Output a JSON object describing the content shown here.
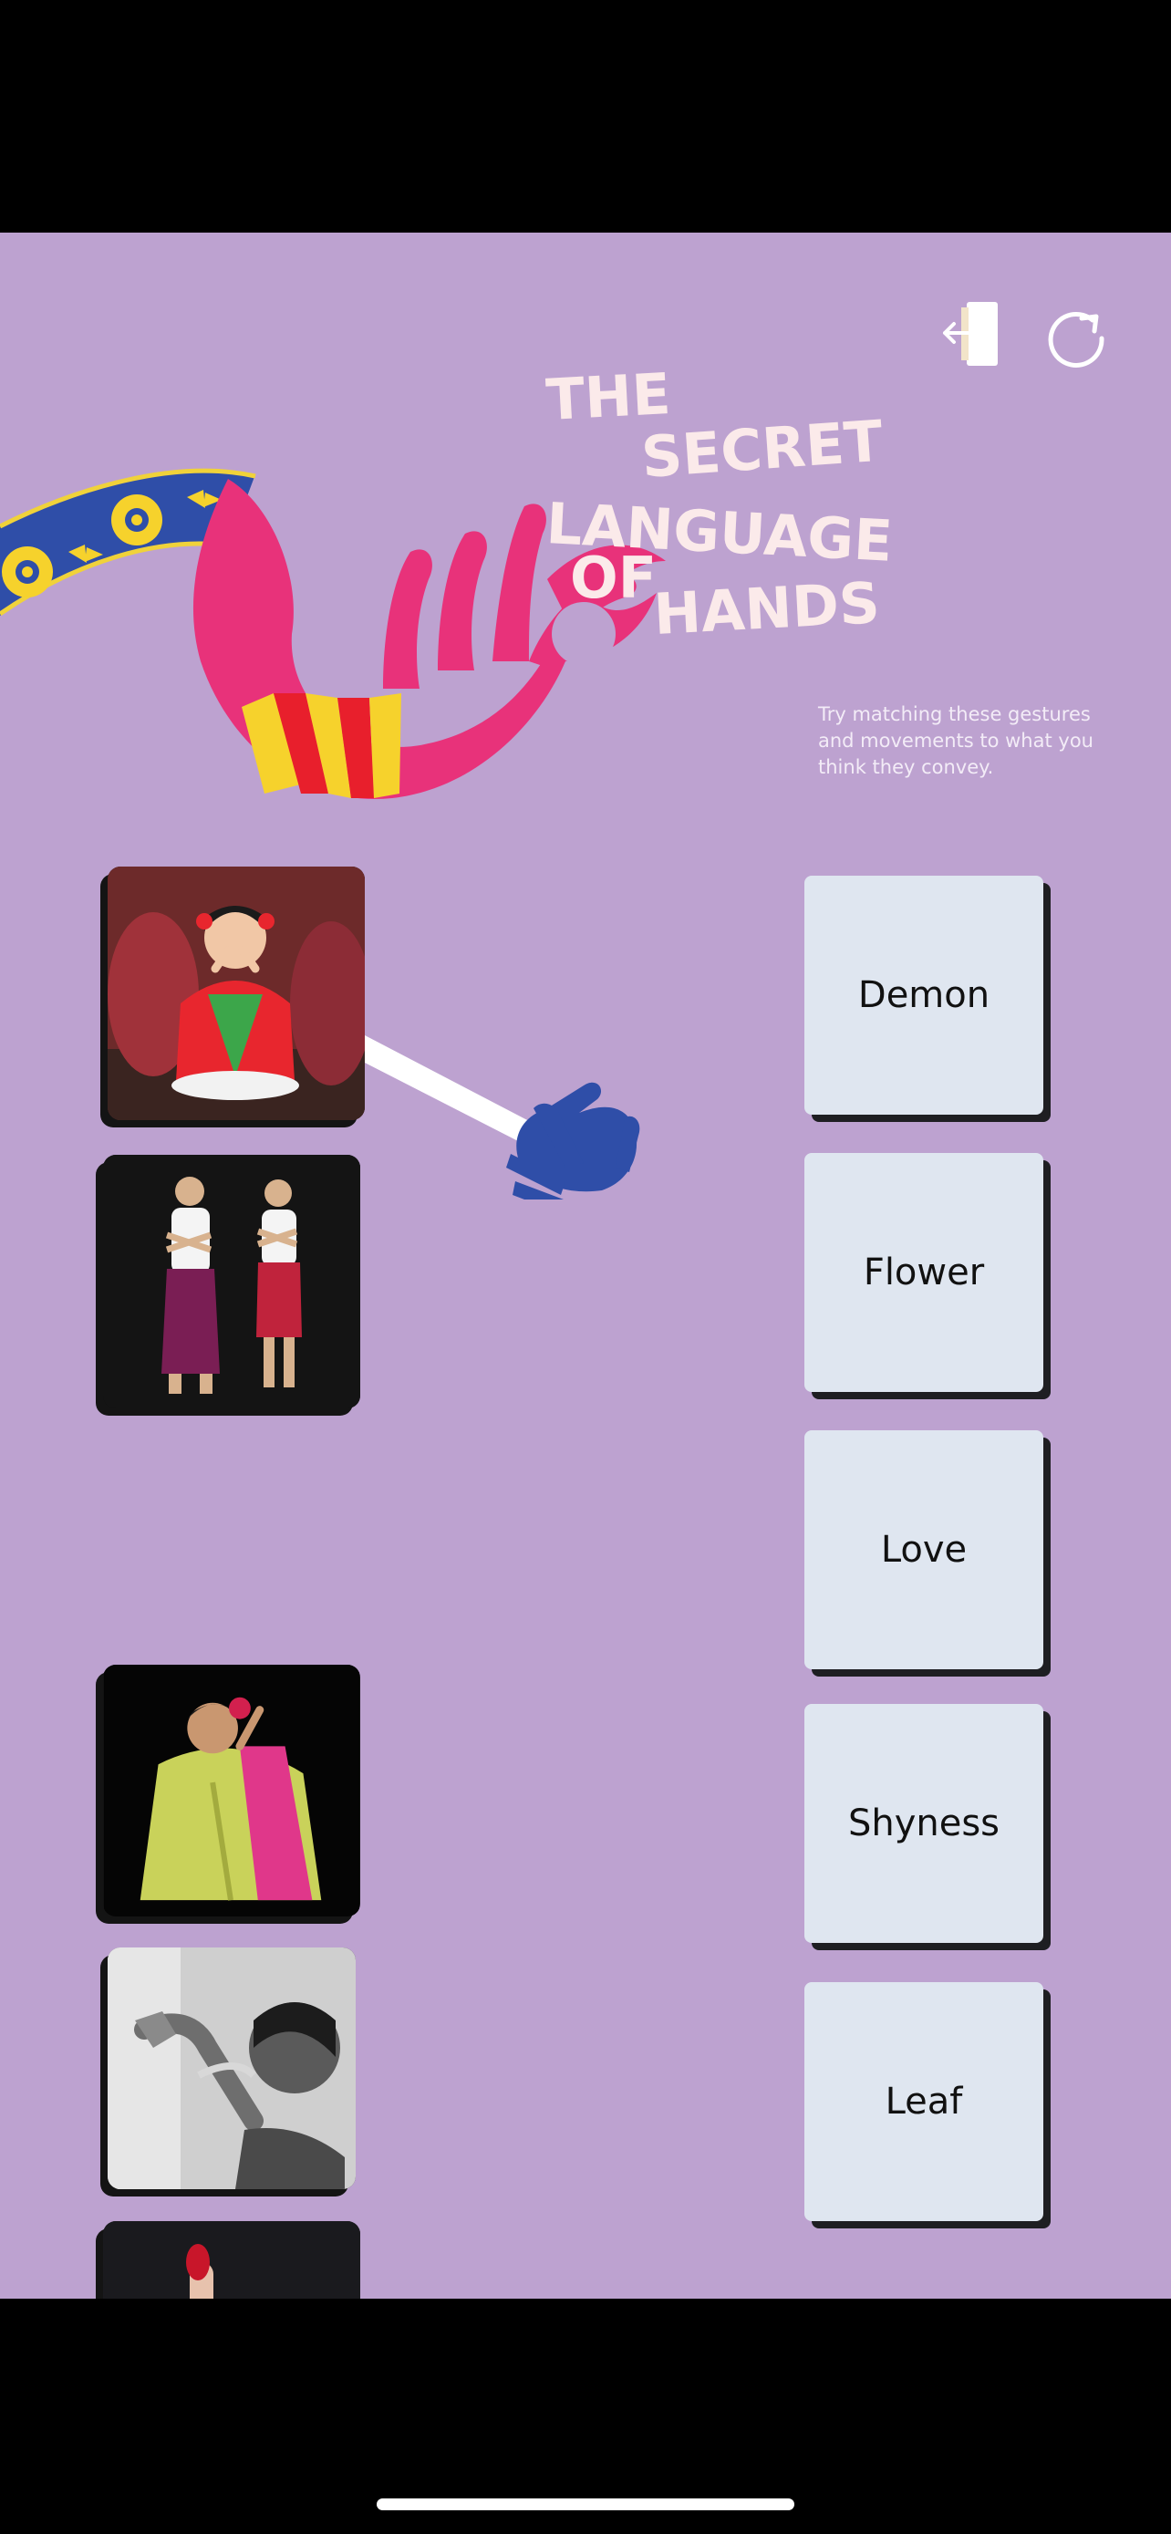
{
  "header": {
    "title_words": [
      "THE",
      "SECRET",
      "LANGUAGE",
      "OF",
      "HANDS"
    ],
    "exit_icon": "exit-door-icon",
    "restart_icon": "restart-icon"
  },
  "instructions": "Try matching these gestures and movements to what you think they convey.",
  "photos": [
    {
      "subject": "child-framing-face-photo"
    },
    {
      "subject": "two-dancers-crossed-arms-photo"
    },
    {
      "subject": "dancer-with-pink-scarf-photo"
    },
    {
      "subject": "dancer-flexed-wrist-bw-photo"
    },
    {
      "subject": "finger-gesture-red-nails-photo"
    }
  ],
  "answers": [
    "Demon",
    "Flower",
    "Love",
    "Shyness",
    "Leaf"
  ],
  "colors": {
    "background": "#bda2d0",
    "title": "#fbeaea",
    "hand_pink": "#e8327a",
    "hand_blue": "#2f4ea8",
    "card": "#dfe6f0"
  }
}
